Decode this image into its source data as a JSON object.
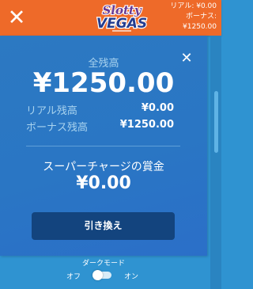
{
  "header": {
    "close_icon": "close-icon",
    "logo_text_line1": "Slotty",
    "logo_text_line2": "VEGAS",
    "real_balance_label": "リアル: ¥0.00",
    "bonus_label": "ボーナス:",
    "bonus_value": "¥1250.00",
    "background_color": "#ee6a29"
  },
  "balance_panel": {
    "close_icon": "close-icon",
    "total_label": "全残高",
    "total_amount": "¥1250.00",
    "real_label": "リアル残高",
    "real_value": "¥0.00",
    "bonus_label": "ボーナス残高",
    "bonus_value": "¥1250.00",
    "supercharge_label": "スーパーチャージの賞金",
    "supercharge_amount": "¥0.00",
    "redeem_button_label": "引き換え",
    "panel_color": "#2a76c4",
    "button_color": "#13447e"
  },
  "dark_mode": {
    "title": "ダークモード",
    "off_label": "オフ",
    "on_label": "オン",
    "state": "off"
  },
  "colors": {
    "page_background": "#2f93d1",
    "logo_purple": "#6a3a92",
    "logo_blue": "#233c8f"
  }
}
